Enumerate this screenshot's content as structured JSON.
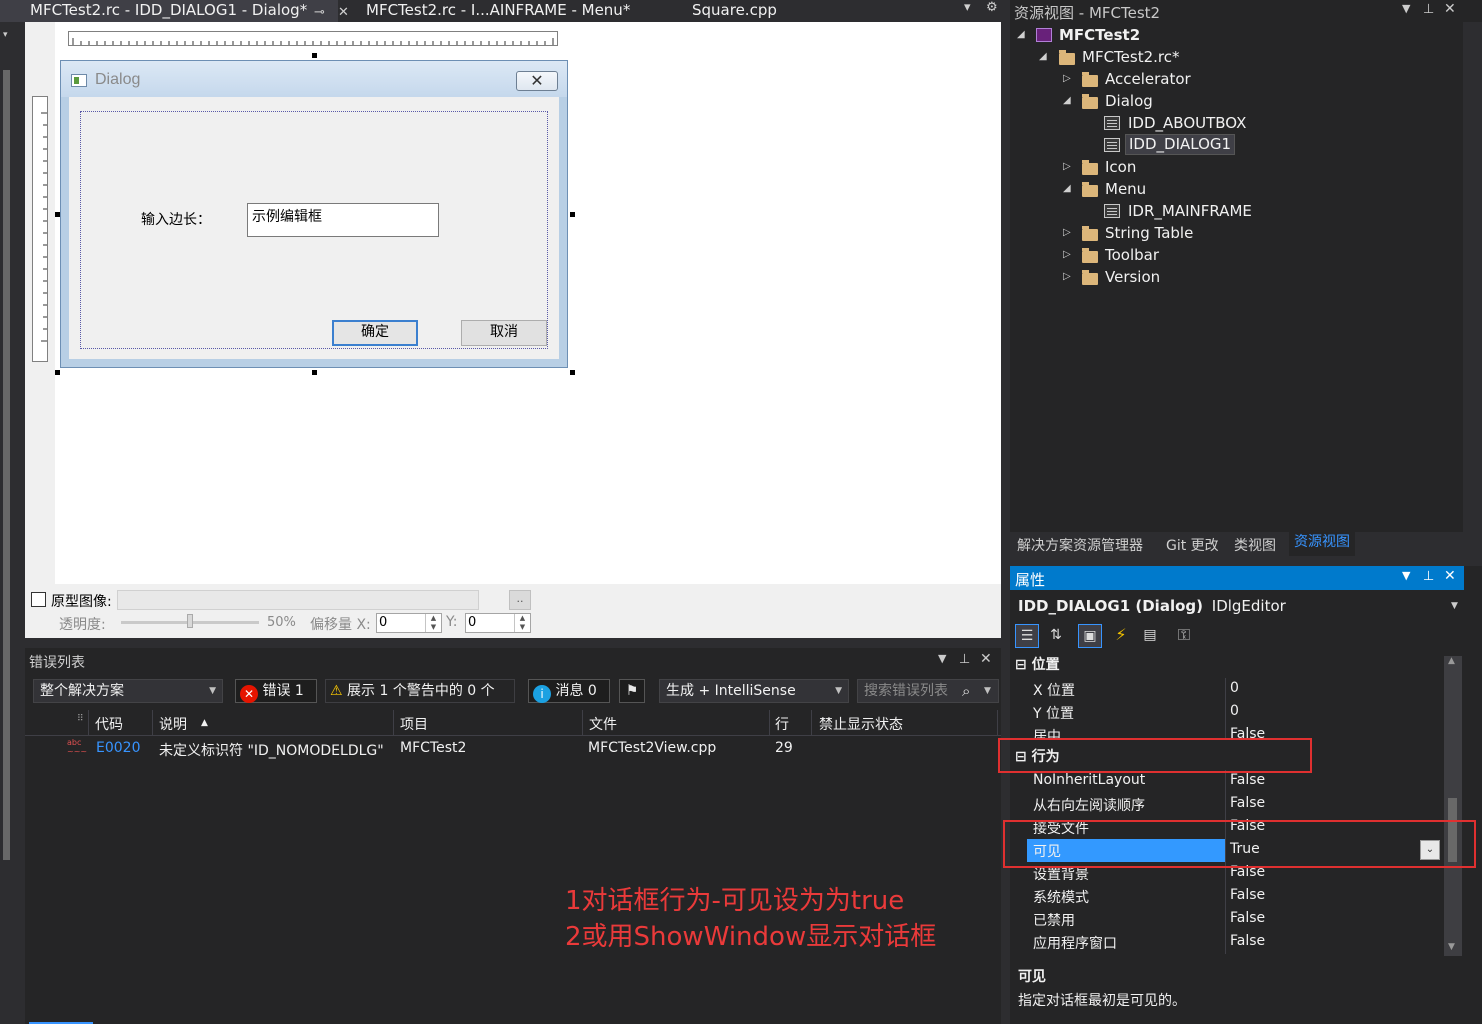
{
  "tabs": [
    {
      "label": "MFCTest2.rc - IDD_DIALOG1 - Dialog*",
      "active": true
    },
    {
      "label": "MFCTest2.rc - I...AINFRAME - Menu*",
      "active": false
    },
    {
      "label": "Square.cpp",
      "active": false
    }
  ],
  "dialog": {
    "title": "Dialog",
    "label": "输入边长：",
    "edit_text": "示例编辑框",
    "ok": "确定",
    "cancel": "取消"
  },
  "proto": {
    "label": "原型图像:",
    "browse": "..",
    "opacity_label": "透明度:",
    "opacity_value": "50%",
    "offset_label": "偏移量 X:",
    "x": "0",
    "y_label": "Y:",
    "y": "0"
  },
  "errors": {
    "title": "错误列表",
    "scope": "整个解决方案",
    "errors_btn": "错误 1",
    "warnings_btn": "展示 1 个警告中的 0 个",
    "messages_btn": "消息 0",
    "build_filter": "生成 + IntelliSense",
    "search_placeholder": "搜索错误列表",
    "columns": [
      "代码",
      "说明",
      "项目",
      "文件",
      "行",
      "禁止显示状态"
    ],
    "rows": [
      {
        "code": "E0020",
        "desc": "未定义标识符 \"ID_NOMODELDLG\"",
        "project": "MFCTest2",
        "file": "MFCTest2View.cpp",
        "line": "29",
        "suppress": ""
      }
    ]
  },
  "annotation": {
    "line1": "1对话框行为-可见设为为true",
    "line2": "2或用ShowWindow显示对话框"
  },
  "resview": {
    "title": "资源视图 - MFCTest2",
    "tree": [
      "MFCTest2",
      "MFCTest2.rc*",
      "Accelerator",
      "Dialog",
      "IDD_ABOUTBOX",
      "IDD_DIALOG1",
      "Icon",
      "Menu",
      "IDR_MAINFRAME",
      "String Table",
      "Toolbar",
      "Version"
    ],
    "tabs": [
      "解决方案资源管理器",
      "Git 更改",
      "类视图",
      "资源视图"
    ]
  },
  "props": {
    "title": "属性",
    "object": "IDD_DIALOG1 (Dialog)",
    "object_type": "IDlgEditor",
    "cat_position": "位置",
    "cat_behavior": "行为",
    "rows": [
      {
        "k": "X 位置",
        "v": "0"
      },
      {
        "k": "Y 位置",
        "v": "0"
      },
      {
        "k": "居中",
        "v": "False"
      },
      {
        "k": "NoInheritLayout",
        "v": "False"
      },
      {
        "k": "从右向左阅读顺序",
        "v": "False"
      },
      {
        "k": "接受文件",
        "v": "False"
      },
      {
        "k": "可见",
        "v": "True"
      },
      {
        "k": "设置背景",
        "v": "False"
      },
      {
        "k": "系统模式",
        "v": "False"
      },
      {
        "k": "已禁用",
        "v": "False"
      },
      {
        "k": "应用程序窗口",
        "v": "False"
      }
    ],
    "desc_title": "可见",
    "desc_text": "指定对话框最初是可见的。"
  },
  "colors": {
    "accent": "#007acc",
    "selection": "#3399ff",
    "annotation": "#ea3a3a"
  }
}
